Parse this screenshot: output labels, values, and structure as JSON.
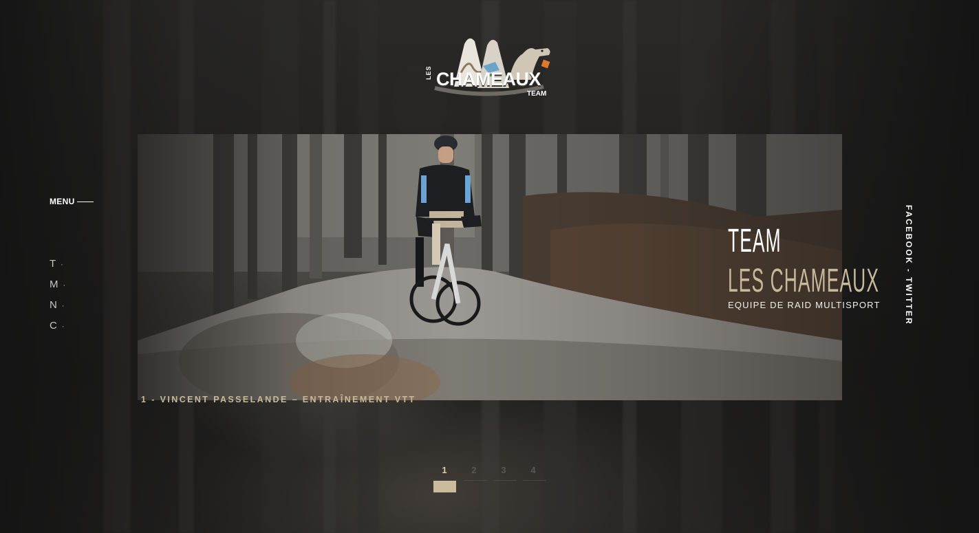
{
  "brand": {
    "logo_small": "LES",
    "logo_main": "CHAMEAUX",
    "logo_sub": "TEAM"
  },
  "menu": {
    "toggle_label": "MENU",
    "items": [
      {
        "label": "T",
        "dot": "·"
      },
      {
        "label": "M",
        "dot": "·"
      },
      {
        "label": "N",
        "dot": "·"
      },
      {
        "label": "C",
        "dot": "·"
      }
    ]
  },
  "hero": {
    "title_line1": "TEAM",
    "title_line2": "LES CHAMEAUX",
    "subtitle": "EQUIPE DE RAID MULTISPORT",
    "caption": "1 - VINCENT PASSELANDE – ENTRAÎNEMENT VTT"
  },
  "social": {
    "facebook": "FACEBOOK",
    "separator": " - ",
    "twitter": "TWITTER"
  },
  "pager": {
    "pages": [
      "1",
      "2",
      "3",
      "4"
    ],
    "active": "1"
  },
  "colors": {
    "accent": "#c8b99a",
    "background": "#1f1e1d",
    "text": "#ffffff"
  }
}
